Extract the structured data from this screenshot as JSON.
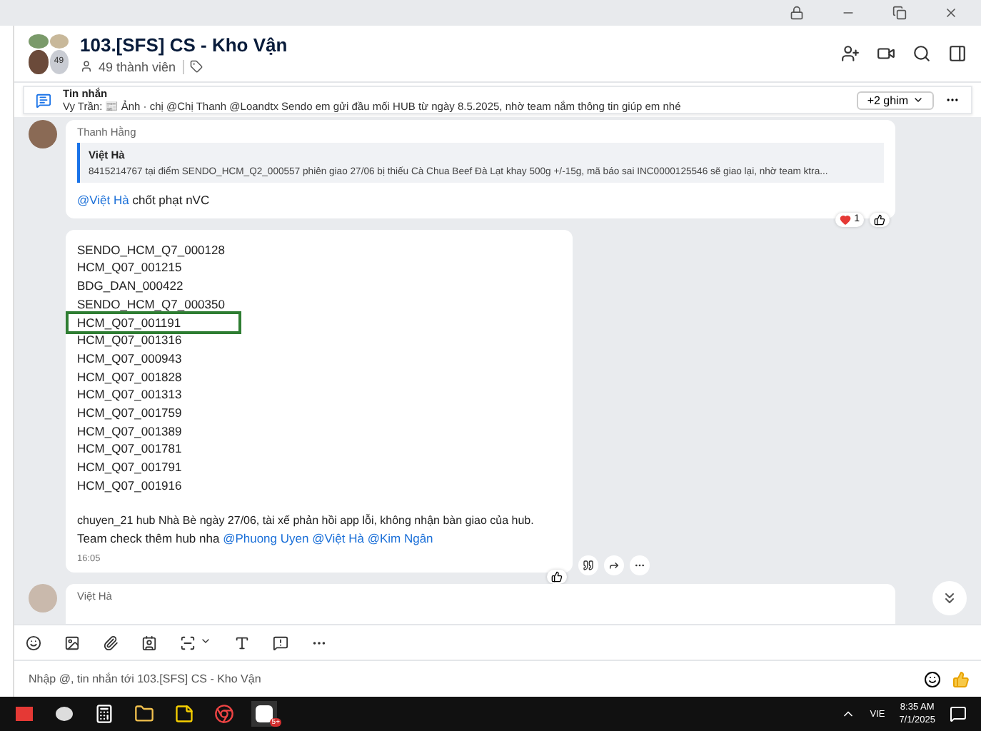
{
  "header": {
    "avatar_count": "49",
    "title": "103.[SFS] CS - Kho Vận",
    "members": "49 thành viên"
  },
  "pinned": {
    "label": "Tin nhắn",
    "text": "Vy Trần: 📰 Ảnh · chị @Chị Thanh @Loandtx Sendo em gửi đầu mối HUB từ ngày 8.5.2025, nhờ team nắm thông tin giúp em nhé",
    "more": "+2 ghim"
  },
  "messages": [
    {
      "kind": "reply",
      "sender": "Thanh Hằng",
      "quote_author": "Việt Hà",
      "quote_text": "8415214767 tại điểm SENDO_HCM_Q2_000557 phiên giao 27/06 bị thiếu Cà Chua Beef Đà Lạt khay 500g +/-15g, mã báo sai INC0000125546 sẽ giao lại, nhờ team ktra...",
      "mention": "@Việt Hà",
      "text": "chốt phạt nVC",
      "reaction_count": "1"
    },
    {
      "kind": "list",
      "lines": [
        {
          "text": "SENDO_HCM_Q7_000128",
          "highlighted": false
        },
        {
          "text": "HCM_Q07_001215",
          "highlighted": false
        },
        {
          "text": "BDG_DAN_000422",
          "highlighted": false
        },
        {
          "text": "SENDO_HCM_Q7_000350",
          "highlighted": false
        },
        {
          "text": "HCM_Q07_001191",
          "highlighted": true
        },
        {
          "text": "HCM_Q07_001316",
          "highlighted": false
        },
        {
          "text": "HCM_Q07_000943",
          "highlighted": false
        },
        {
          "text": "HCM_Q07_001828",
          "highlighted": false
        },
        {
          "text": "HCM_Q07_001313",
          "highlighted": false
        },
        {
          "text": "HCM_Q07_001759",
          "highlighted": false
        },
        {
          "text": "HCM_Q07_001389",
          "highlighted": false
        },
        {
          "text": "HCM_Q07_001781",
          "highlighted": false
        },
        {
          "text": "HCM_Q07_001791",
          "highlighted": false
        },
        {
          "text": "HCM_Q07_001916",
          "highlighted": false
        }
      ],
      "body": "chuyen_21 hub Nhà Bè ngày 27/06, tài xế phản hồi app lỗi, không nhận bàn giao của hub.",
      "body2": "Team check thêm hub nha",
      "mentions": [
        "@Phuong Uyen",
        "@Việt Hà",
        "@Kim Ngân"
      ],
      "time": "16:05"
    },
    {
      "kind": "partial",
      "sender": "Việt Hà"
    }
  ],
  "composer": {
    "placeholder": "Nhập @, tin nhắn tới 103.[SFS] CS - Kho Vận"
  },
  "taskbar": {
    "badge": "5+",
    "language": "VIE",
    "time": "8:35 AM",
    "date": "7/1/2025"
  }
}
